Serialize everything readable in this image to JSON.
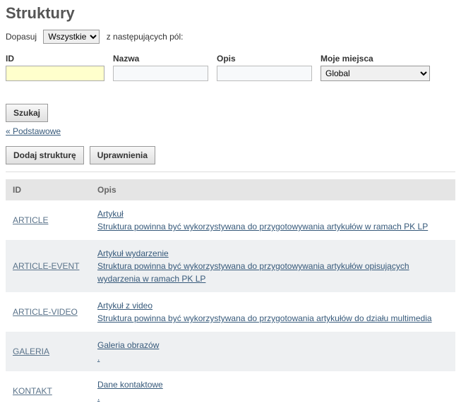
{
  "page_title": "Struktury",
  "match": {
    "prefix": "Dopasuj",
    "select_value": "Wszystkie",
    "suffix": "z następujących pól:"
  },
  "fields": {
    "id": {
      "label": "ID",
      "value": ""
    },
    "name": {
      "label": "Nazwa",
      "value": ""
    },
    "desc": {
      "label": "Opis",
      "value": ""
    },
    "place": {
      "label": "Moje miejsca",
      "value": "Global"
    }
  },
  "buttons": {
    "search": "Szukaj",
    "toggle_basic": "« Podstawowe",
    "add_structure": "Dodaj strukturę",
    "permissions": "Uprawnienia"
  },
  "table": {
    "headers": {
      "id": "ID",
      "desc": "Opis"
    },
    "rows": [
      {
        "id": "ARTICLE",
        "title": "Artykuł",
        "body": "Struktura powinna być wykorzystywana do przygotowywania artykułów w ramach PK LP"
      },
      {
        "id": "ARTICLE-EVENT",
        "title": "Artykuł wydarzenie",
        "body": "Struktura powinna być wykorzystywana do przygotowywania artykułów opisujących wydarzenia w ramach PK LP"
      },
      {
        "id": "ARTICLE-VIDEO",
        "title": "Artykuł z video",
        "body": "Struktura powinna być wykorzystywana do przygotowania artykułów do działu multimedia"
      },
      {
        "id": "GALERIA",
        "title": "Galeria obrazów",
        "body": "."
      },
      {
        "id": "KONTAKT",
        "title": "Dane kontaktowe",
        "body": "."
      }
    ]
  }
}
